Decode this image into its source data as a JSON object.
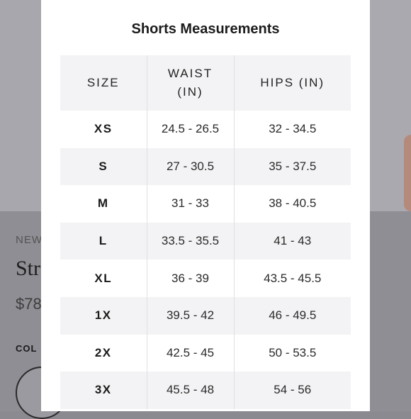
{
  "background": {
    "badge": "NEW",
    "product_name_partial": "Stra",
    "price_partial": "$78",
    "color_label_partial": "COL"
  },
  "modal": {
    "title": "Shorts Measurements",
    "headers": {
      "size": "SIZE",
      "waist_line1": "WAIST",
      "waist_line2": "(IN)",
      "hips": "HIPS (IN)"
    },
    "rows": [
      {
        "size": "XS",
        "waist": "24.5 - 26.5",
        "hips": "32 - 34.5"
      },
      {
        "size": "S",
        "waist": "27 - 30.5",
        "hips": "35 - 37.5"
      },
      {
        "size": "M",
        "waist": "31 - 33",
        "hips": "38 - 40.5"
      },
      {
        "size": "L",
        "waist": "33.5 - 35.5",
        "hips": "41 - 43"
      },
      {
        "size": "XL",
        "waist": "36 - 39",
        "hips": "43.5 - 45.5"
      },
      {
        "size": "1X",
        "waist": "39.5 - 42",
        "hips": "46 - 49.5"
      },
      {
        "size": "2X",
        "waist": "42.5 - 45",
        "hips": "50 - 53.5"
      },
      {
        "size": "3X",
        "waist": "45.5 - 48",
        "hips": "54 - 56"
      }
    ]
  }
}
